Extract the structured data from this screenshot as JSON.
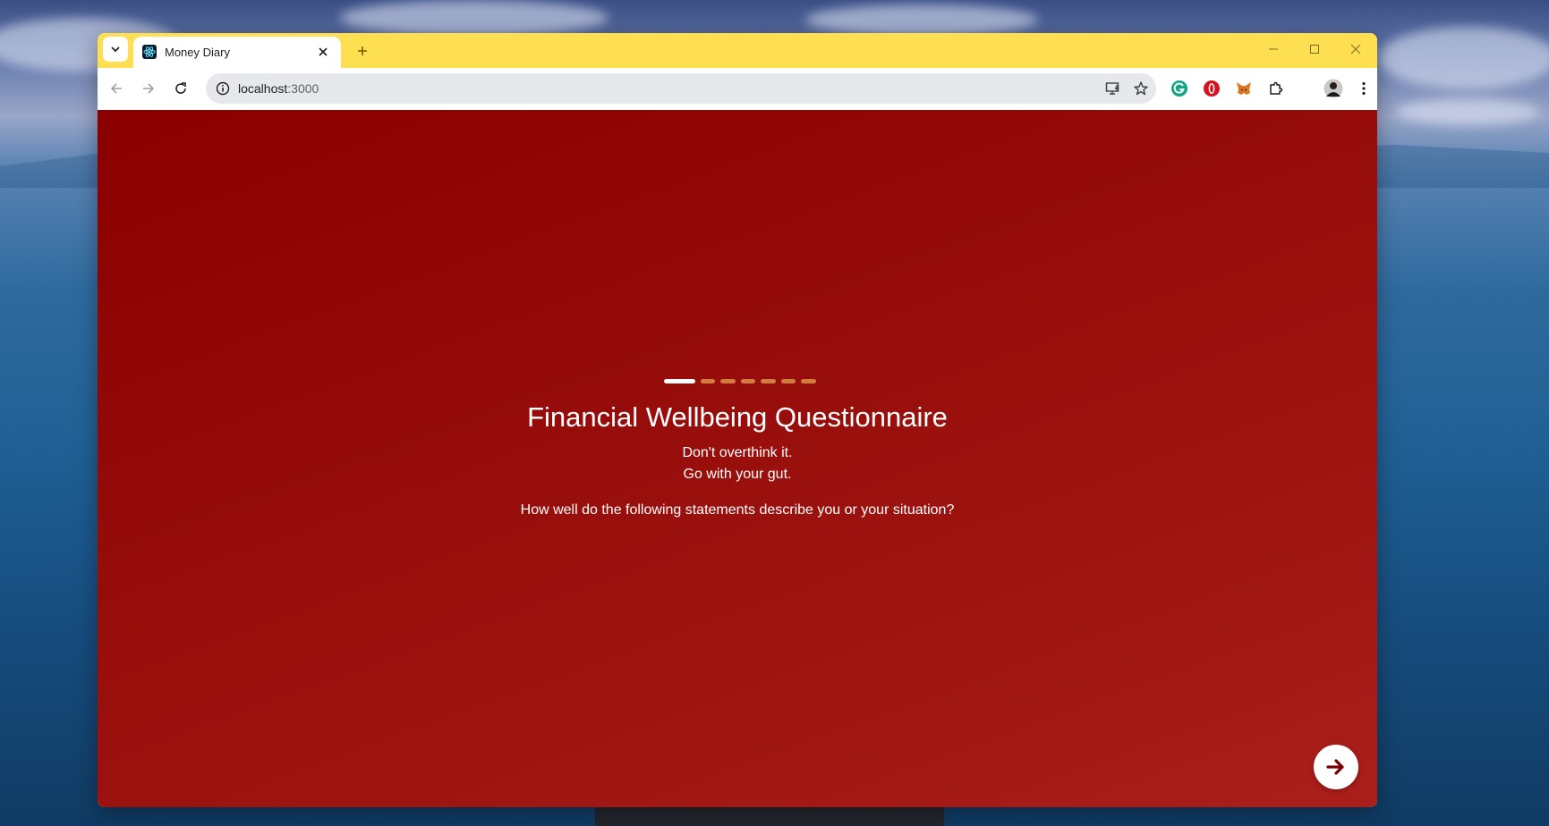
{
  "browser": {
    "tab": {
      "title": "Money Diary"
    },
    "url": {
      "host": "localhost",
      "path": ":3000"
    }
  },
  "page": {
    "progress": {
      "total_steps": 7,
      "current_step": 1
    },
    "title": "Financial Wellbeing Questionnaire",
    "subtitle_line1": "Don't overthink it.",
    "subtitle_line2": "Go with your gut.",
    "question": "How well do the following statements describe you or your situation?"
  },
  "colors": {
    "tab_strip": "#fddf51",
    "page_background": "#8a0000",
    "progress_inactive": "#d27d3e",
    "progress_active": "#ffffff",
    "next_arrow": "#7a0000"
  },
  "icons": {
    "tab_list": "chevron-down-icon",
    "favicon": "react-icon",
    "close_tab": "close-icon",
    "new_tab": "plus-icon",
    "back": "arrow-left-icon",
    "forward": "arrow-right-icon",
    "reload": "reload-icon",
    "site_info": "info-icon",
    "install": "install-app-icon",
    "bookmark": "star-icon",
    "next": "arrow-right-icon"
  }
}
